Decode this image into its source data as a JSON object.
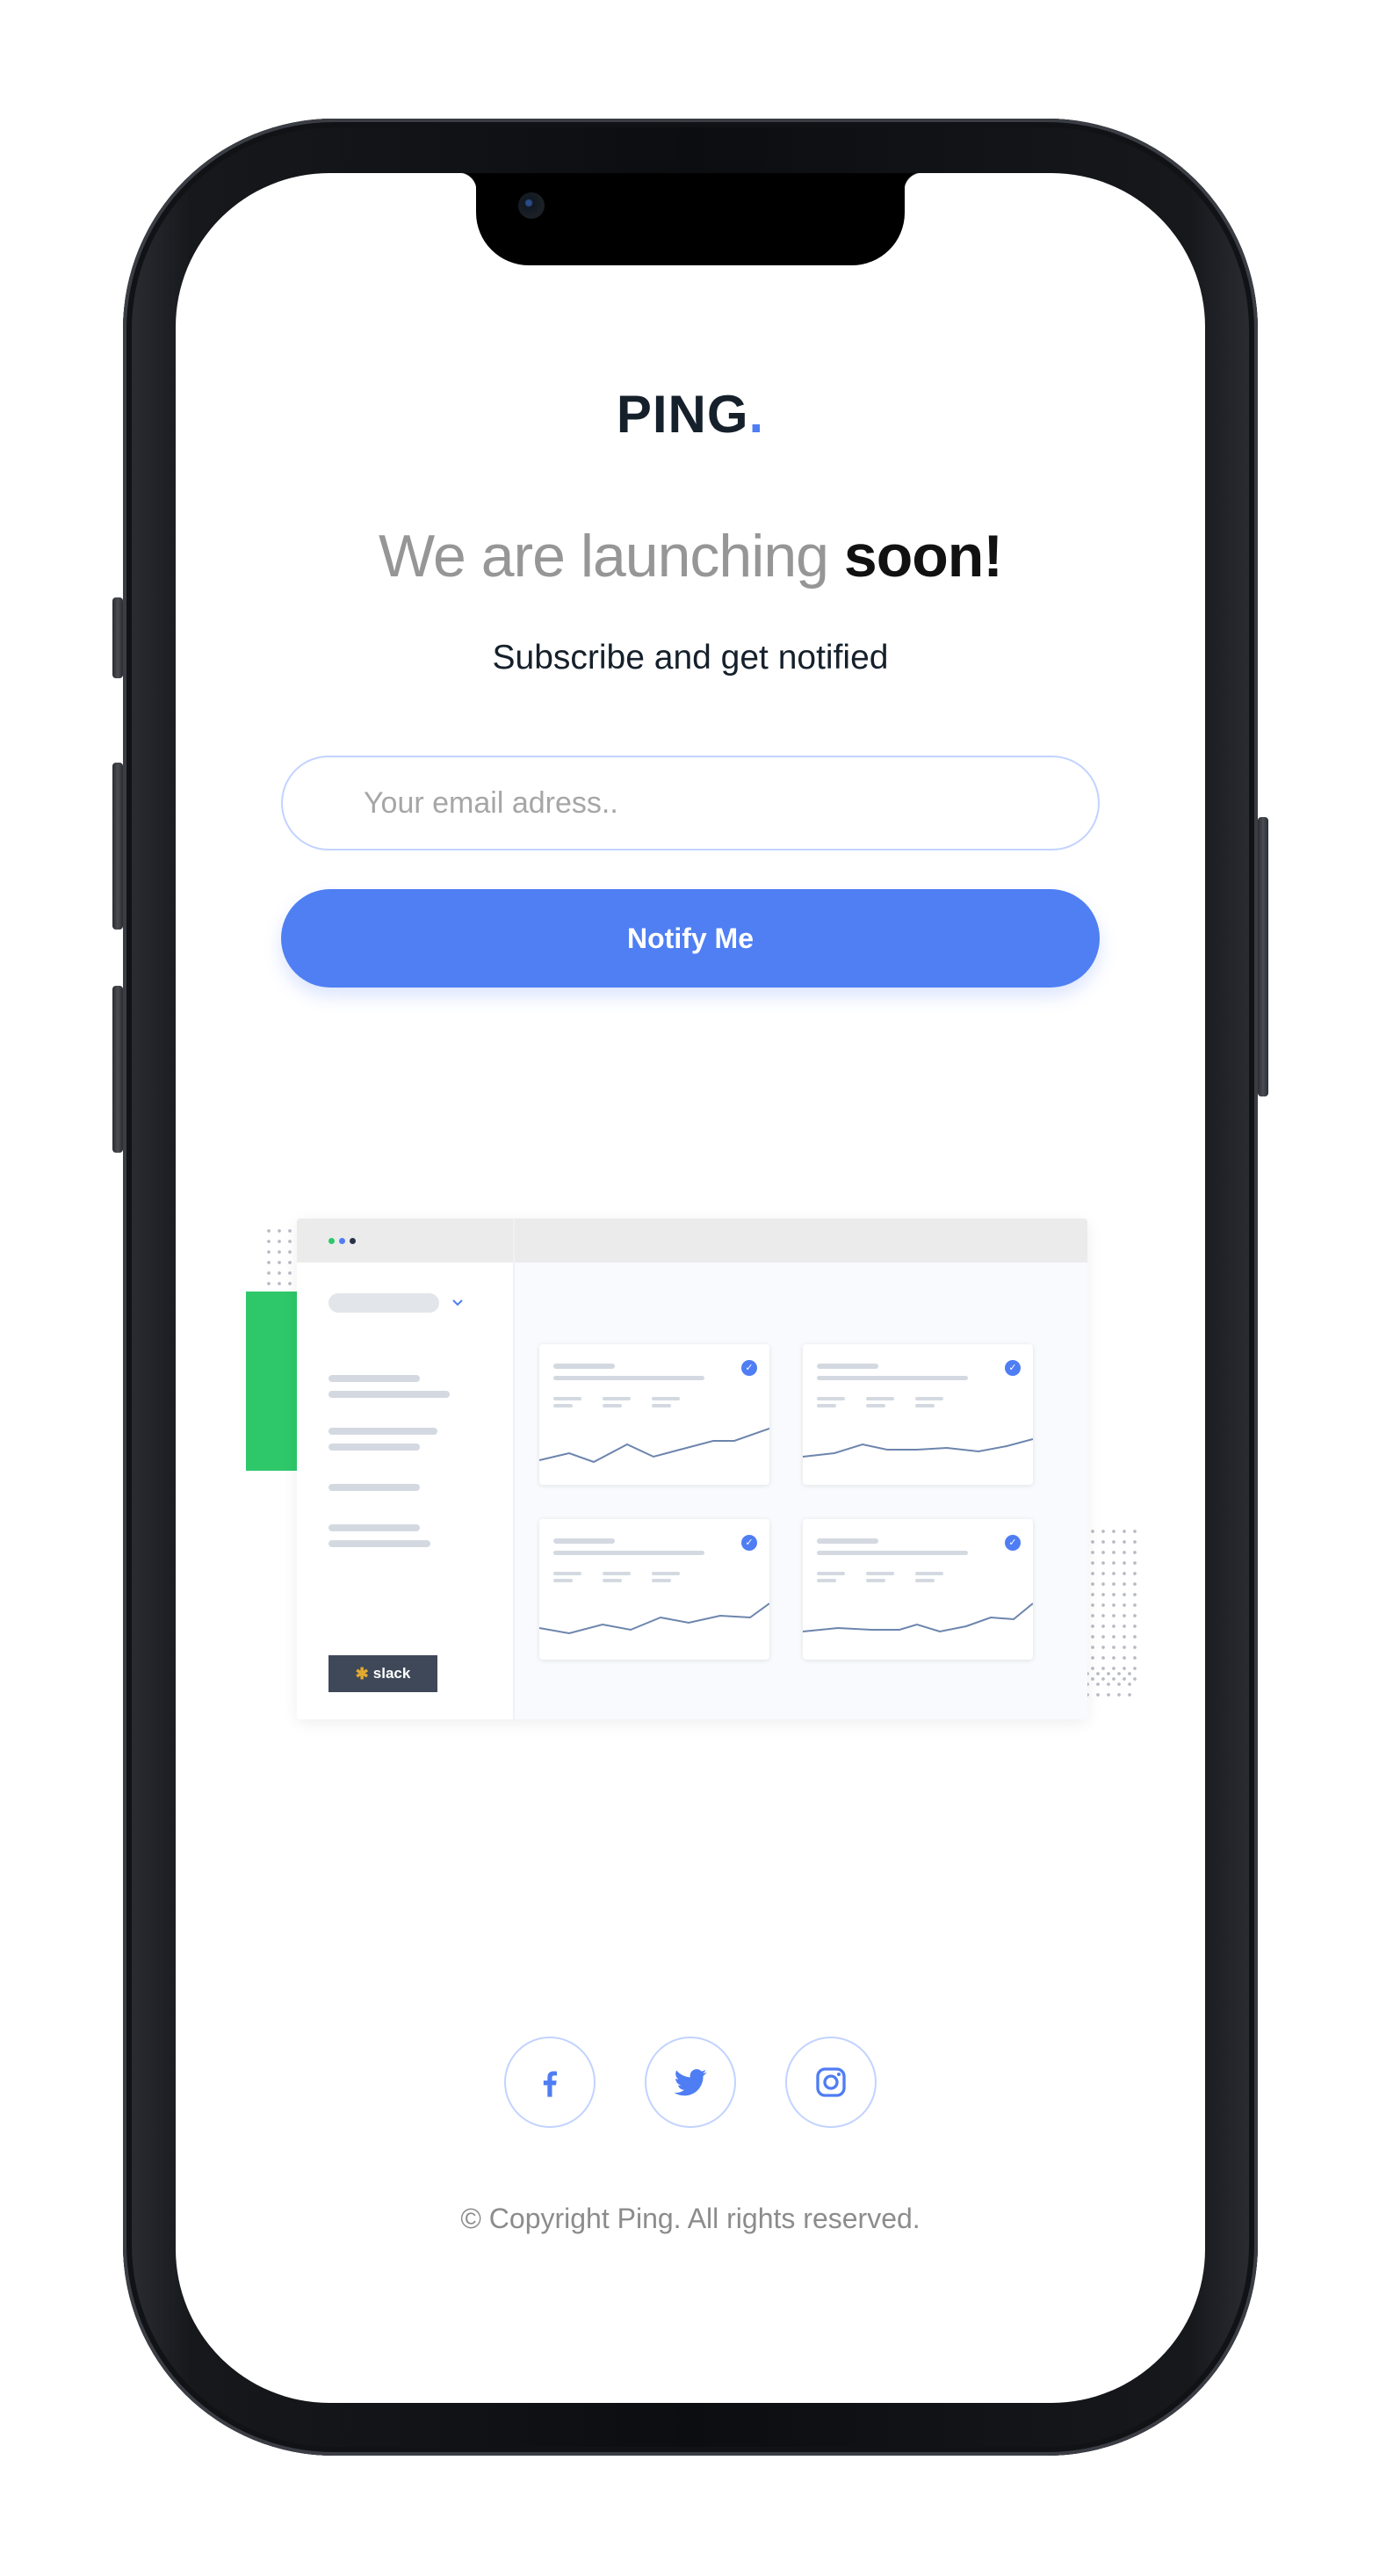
{
  "brand": {
    "name": "PING",
    "dot": ".",
    "accent_color": "#4f7df3"
  },
  "hero": {
    "headline_light": "We are launching ",
    "headline_bold": "soon!",
    "subtitle": "Subscribe and get notified"
  },
  "form": {
    "email_placeholder": "Your email adress..",
    "email_value": "",
    "submit_label": "Notify Me"
  },
  "illustration": {
    "slack_label": "slack",
    "green_color": "#2ec86a"
  },
  "social": {
    "icons": [
      "facebook-icon",
      "twitter-icon",
      "instagram-icon"
    ]
  },
  "footer": {
    "copyright": "© Copyright Ping. All rights reserved."
  }
}
